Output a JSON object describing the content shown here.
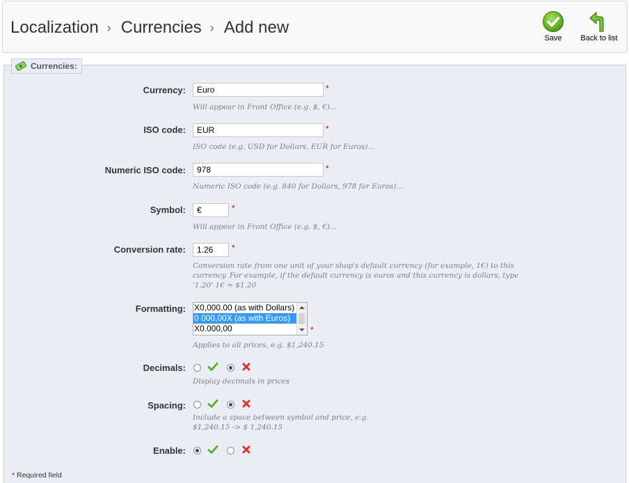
{
  "breadcrumb": {
    "items": [
      "Localization",
      "Currencies",
      "Add new"
    ],
    "separator": "›"
  },
  "toolbar": {
    "save_label": "Save",
    "back_label": "Back to list"
  },
  "fieldset": {
    "legend": "Currencies:"
  },
  "form": {
    "currency": {
      "label": "Currency:",
      "value": "Euro",
      "required": "*",
      "hint": "Will appear in Front Office (e.g. $, €)..."
    },
    "iso_code": {
      "label": "ISO code:",
      "value": "EUR",
      "required": "*",
      "hint": "ISO code (e.g. USD for Dollars, EUR for Euros)..."
    },
    "numeric_iso": {
      "label": "Numeric ISO code:",
      "value": "978",
      "required": "*",
      "hint": "Numeric ISO code (e.g. 840 for Dollars, 978 for Euros)..."
    },
    "symbol": {
      "label": "Symbol:",
      "value": "€",
      "required": "*",
      "hint": "Will appear in Front Office (e.g. $, €)..."
    },
    "conversion_rate": {
      "label": "Conversion rate:",
      "value": "1.26",
      "required": "*",
      "hint_lines": [
        "Conversion rate from one unit of your shop's default currency (for example, 1€) to this",
        "currency. For example, if the default currency is euros and this currency is dollars, type",
        "'1.20' 1€ = $1.20"
      ]
    },
    "formatting": {
      "label": "Formatting:",
      "options": [
        "X0,000.00 (as with Dollars)",
        "0 000,00X (as with Euros)",
        "X0.000,00"
      ],
      "selected": "0 000,00X (as with Euros)",
      "required": "*",
      "hint": "Applies to all prices, e.g. $1,240.15"
    },
    "decimals": {
      "label": "Decimals:",
      "selected": "no",
      "hint": "Display decimals in prices"
    },
    "spacing": {
      "label": "Spacing:",
      "selected": "no",
      "hint_lines": [
        "Include a space between symbol and price, e.g.",
        "$1,240.15 -> $ 1,240.15"
      ]
    },
    "enable": {
      "label": "Enable:",
      "selected": "yes"
    }
  },
  "footnote": {
    "star": "*",
    "text": " Required field"
  },
  "colors": {
    "accent_green": "#4caf1f",
    "accent_red": "#e03030",
    "selection_blue": "#3399ff",
    "fieldset_bg": "#ebedf4"
  },
  "icons": {
    "save": "check-circle-icon",
    "back": "back-arrow-icon",
    "legend": "money-icon",
    "yes": "check-icon",
    "no": "cross-icon"
  }
}
